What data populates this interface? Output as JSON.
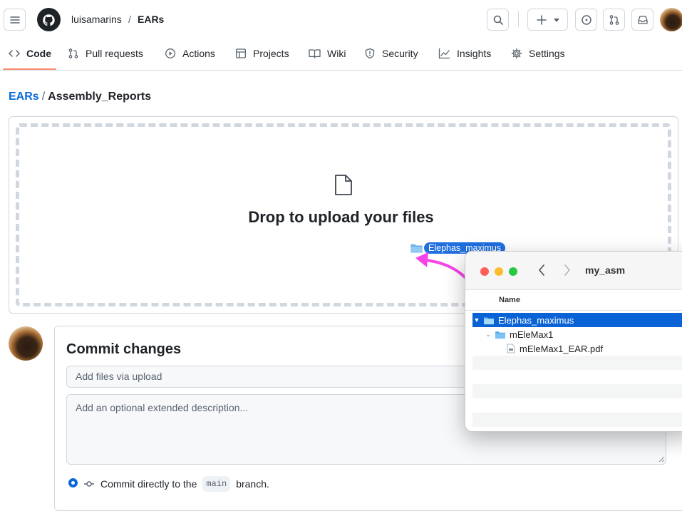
{
  "repo": {
    "owner": "luisamarins",
    "separator": "/",
    "name": "EARs"
  },
  "tabs": [
    {
      "label": "Code",
      "icon": "code-icon"
    },
    {
      "label": "Pull requests",
      "icon": "git-pull-request-icon"
    },
    {
      "label": "Actions",
      "icon": "play-icon"
    },
    {
      "label": "Projects",
      "icon": "table-icon"
    },
    {
      "label": "Wiki",
      "icon": "book-icon"
    },
    {
      "label": "Security",
      "icon": "shield-icon"
    },
    {
      "label": "Insights",
      "icon": "graph-icon"
    },
    {
      "label": "Settings",
      "icon": "gear-icon"
    }
  ],
  "breadcrumb": {
    "repo": "EARs",
    "separator": "/",
    "folder": "Assembly_Reports"
  },
  "dropzone": {
    "title": "Drop to upload your files",
    "drag_label": "Elephas_maximus"
  },
  "commit": {
    "title": "Commit changes",
    "summary_placeholder": "Add files via upload",
    "description_placeholder": "Add an optional extended description...",
    "radio_prefix": "Commit directly to the",
    "branch": "main",
    "radio_suffix": "branch."
  },
  "finder": {
    "title": "my_asm",
    "column": "Name",
    "rows": [
      {
        "label": "Elephas_maximus",
        "type": "folder",
        "selected": true
      },
      {
        "label": "mEleMax1",
        "type": "folder",
        "selected": false
      },
      {
        "label": "mEleMax1_EAR.pdf",
        "type": "pdf",
        "selected": false
      }
    ]
  },
  "colors": {
    "accent": "#0969da",
    "tab_underline": "#fd8c73",
    "drag_arrow": "#f545e8",
    "finder_selection": "#0a63d6"
  }
}
